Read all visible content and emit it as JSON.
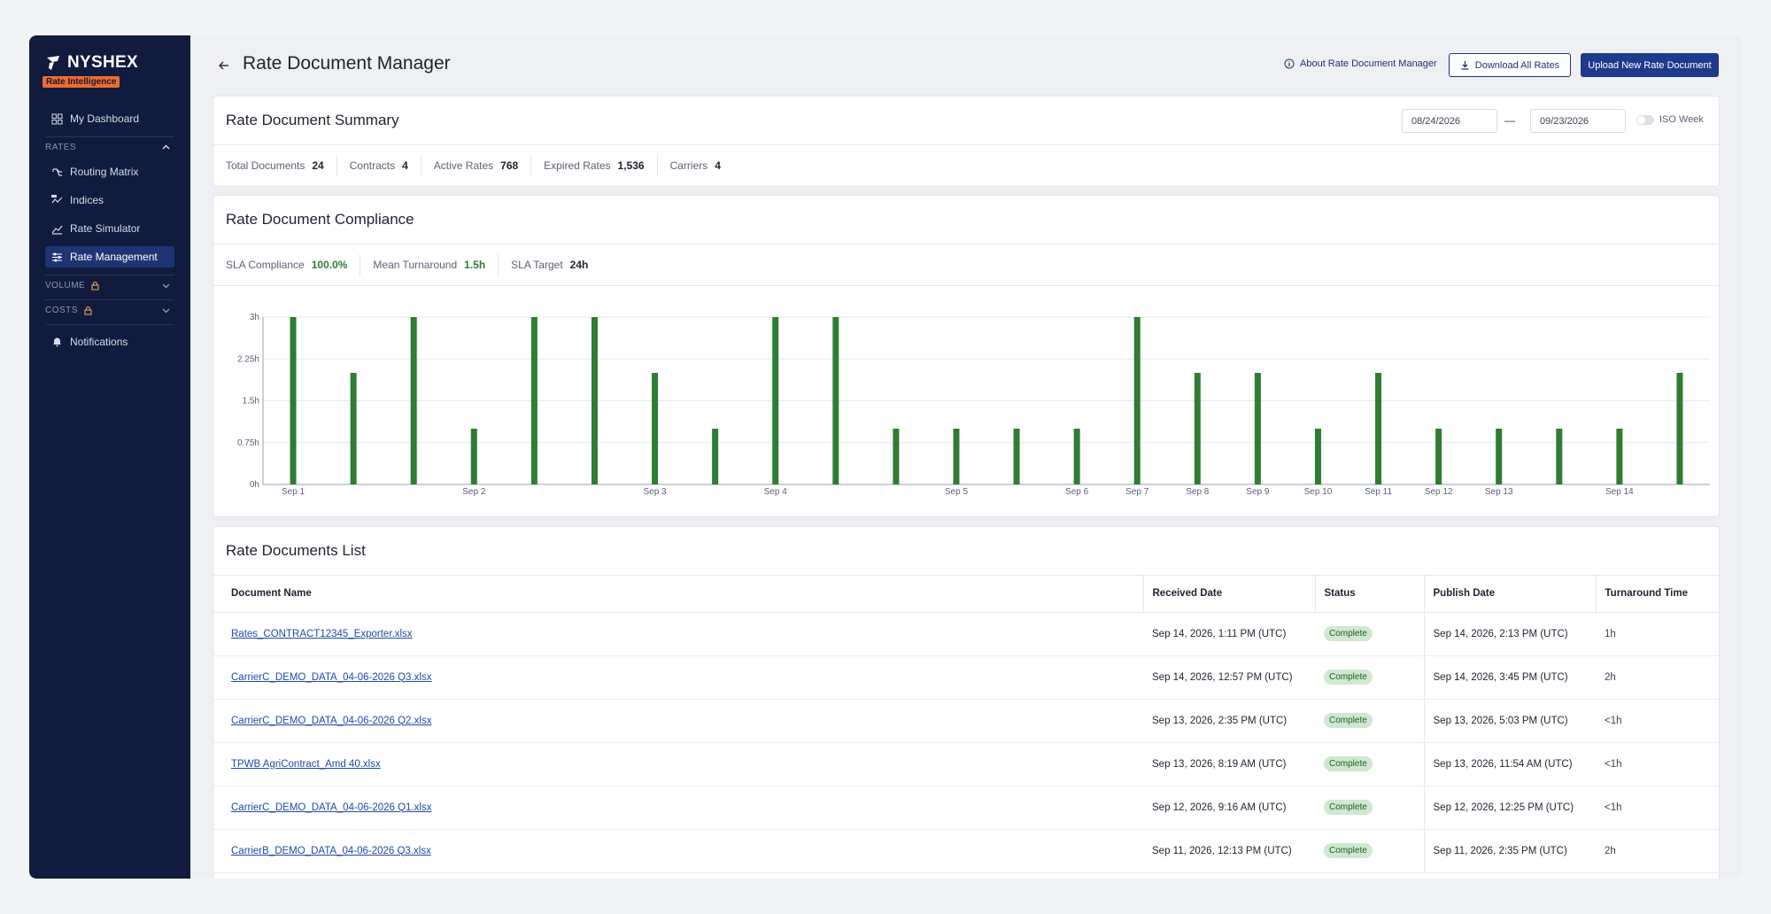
{
  "sidebar": {
    "brand": "NYSHEX",
    "badge": "Rate Intelligence",
    "dashboard": "My Dashboard",
    "rates_section": "RATES",
    "rates_items": [
      "Routing Matrix",
      "Indices",
      "Rate Simulator",
      "Rate Management"
    ],
    "volume_section": "VOLUME",
    "costs_section": "COSTS",
    "notifications": "Notifications"
  },
  "header": {
    "title": "Rate Document Manager",
    "about": "About Rate Document Manager",
    "download": "Download All Rates",
    "upload": "Upload New Rate Document"
  },
  "summary": {
    "title": "Rate Document Summary",
    "date_from": "08/24/2026",
    "date_sep": "—",
    "date_to": "09/23/2026",
    "iso_week": "ISO Week",
    "stats": [
      {
        "k": "Total Documents",
        "v": "24"
      },
      {
        "k": "Contracts",
        "v": "4"
      },
      {
        "k": "Active Rates",
        "v": "768"
      },
      {
        "k": "Expired Rates",
        "v": "1,536"
      },
      {
        "k": "Carriers",
        "v": "4"
      }
    ]
  },
  "compliance": {
    "title": "Rate Document Compliance",
    "stats": [
      {
        "k": "SLA Compliance",
        "v": "100.0%"
      },
      {
        "k": "Mean Turnaround",
        "v": "1.5h"
      },
      {
        "k": "SLA Target",
        "v": "24h"
      }
    ]
  },
  "chart_data": {
    "type": "bar",
    "ylim": [
      0,
      3
    ],
    "yticks": [
      "0h",
      "0.75h",
      "1.5h",
      "2.25h",
      "3h"
    ],
    "grid": true,
    "bar_color": "#2e7d32",
    "values": [
      3,
      2,
      3,
      1,
      3,
      3,
      2,
      1,
      3,
      3,
      1,
      1,
      1,
      1,
      3,
      2,
      2,
      1,
      2,
      1,
      1,
      1,
      1,
      2
    ],
    "xtick_labels": [
      {
        "label": "Sep 1",
        "at": 0
      },
      {
        "label": "Sep 2",
        "at": 3
      },
      {
        "label": "Sep 3",
        "at": 6
      },
      {
        "label": "Sep 4",
        "at": 8
      },
      {
        "label": "Sep 5",
        "at": 11
      },
      {
        "label": "Sep 6",
        "at": 13
      },
      {
        "label": "Sep 7",
        "at": 14
      },
      {
        "label": "Sep 8",
        "at": 15
      },
      {
        "label": "Sep 9",
        "at": 16
      },
      {
        "label": "Sep 10",
        "at": 17
      },
      {
        "label": "Sep 11",
        "at": 18
      },
      {
        "label": "Sep 12",
        "at": 19
      },
      {
        "label": "Sep 13",
        "at": 20
      },
      {
        "label": "Sep 14",
        "at": 22
      }
    ]
  },
  "list": {
    "title": "Rate Documents List",
    "columns": [
      "Document Name",
      "Received Date",
      "Status",
      "Publish Date",
      "Turnaround Time"
    ],
    "rows": [
      [
        "Rates_CONTRACT12345_Exporter.xlsx",
        "Sep 14, 2026, 1:11 PM (UTC)",
        "Complete",
        "Sep 14, 2026, 2:13 PM (UTC)",
        "1h"
      ],
      [
        "CarrierC_DEMO_DATA_04-06-2026 Q3.xlsx",
        "Sep 14, 2026, 12:57 PM (UTC)",
        "Complete",
        "Sep 14, 2026, 3:45 PM (UTC)",
        "2h"
      ],
      [
        "CarrierC_DEMO_DATA_04-06-2026 Q2.xlsx",
        "Sep 13, 2026, 2:35 PM (UTC)",
        "Complete",
        "Sep 13, 2026, 5:03 PM (UTC)",
        "<1h"
      ],
      [
        "TPWB AgriContract_Amd 40.xlsx",
        "Sep 13, 2026, 8:19 AM (UTC)",
        "Complete",
        "Sep 13, 2026, 11:54 AM (UTC)",
        "<1h"
      ],
      [
        "CarrierC_DEMO_DATA_04-06-2026 Q1.xlsx",
        "Sep 12, 2026, 9:16 AM (UTC)",
        "Complete",
        "Sep 12, 2026, 12:25 PM (UTC)",
        "<1h"
      ],
      [
        "CarrierB_DEMO_DATA_04-06-2026 Q3.xlsx",
        "Sep 11, 2026, 12:13 PM (UTC)",
        "Complete",
        "Sep 11, 2026, 2:35 PM (UTC)",
        "2h"
      ]
    ]
  }
}
